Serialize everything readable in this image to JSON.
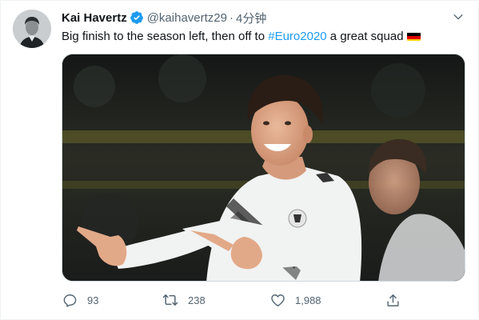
{
  "tweet": {
    "author_name": "Kai Havertz",
    "handle": "@kaihavertz29",
    "separator": "·",
    "timestamp": "4分钟",
    "verified": true,
    "text_before": "Big finish to the season left, then off to ",
    "hashtag": "#Euro2020",
    "text_after": " a great squad",
    "flag_icon": "germany-flag-icon",
    "more_icon": "chevron-down-icon",
    "media_description": "photo"
  },
  "actions": {
    "reply_count": "93",
    "retweet_count": "238",
    "like_count": "1,988",
    "reply_icon": "reply-icon",
    "retweet_icon": "retweet-icon",
    "like_icon": "heart-icon",
    "share_icon": "share-icon"
  },
  "colors": {
    "text": "#0f1419",
    "secondary": "#536471",
    "link": "#1d9bf0",
    "verified": "#1d9bf0"
  }
}
